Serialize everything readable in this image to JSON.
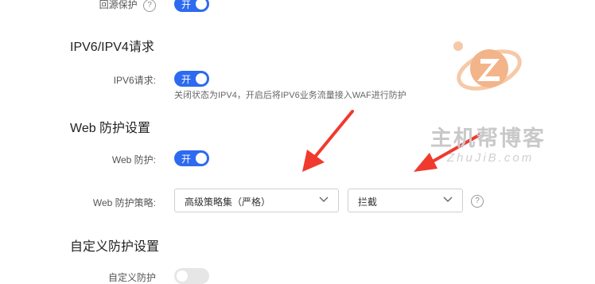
{
  "origin_protect": {
    "label": "回源保护",
    "toggle": "开",
    "help": "?"
  },
  "ipv6": {
    "section_title": "IPV6/IPV4请求",
    "label": "IPV6请求:",
    "toggle": "开",
    "hint": "关闭状态为IPV4，开启后将IPV6业务流量接入WAF进行防护"
  },
  "web_protect": {
    "section_title": "Web 防护设置",
    "switch_label": "Web 防护:",
    "toggle": "开",
    "strategy_label": "Web 防护策略:",
    "strategy_value": "高级策略集（严格）",
    "action_value": "拦截",
    "help": "?"
  },
  "custom_protect": {
    "section_title": "自定义防护设置",
    "row_label": "自定义防护"
  },
  "watermark": {
    "brand": "主机帮博客",
    "domain": "ZhuJiB.com"
  },
  "colors": {
    "accent": "#2d6af0",
    "arrow": "#f03a2e"
  }
}
